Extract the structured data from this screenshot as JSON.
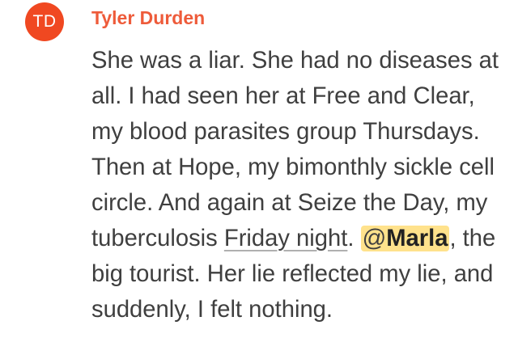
{
  "comment": {
    "avatar_initials": "TD",
    "author": "Tyler Durden",
    "text_before_link": "She was a liar. She had no diseases at all. I had seen her at Free and Clear, my blood parasites group Thursdays. Then at Hope, my bimonthly sickle cell circle. And again at Seize the Day, my tuberculosis ",
    "link_text": "Friday night",
    "text_between": ". ",
    "mention_prefix": "@",
    "mention_name": "Marla",
    "text_after": ", the big tourist. Her lie reflected my lie, and suddenly, I felt nothing."
  },
  "colors": {
    "avatar_bg": "#f04821",
    "author": "#ee5b3a",
    "mention_highlight": "#ffe28c",
    "body_text": "#3f3f3f"
  }
}
